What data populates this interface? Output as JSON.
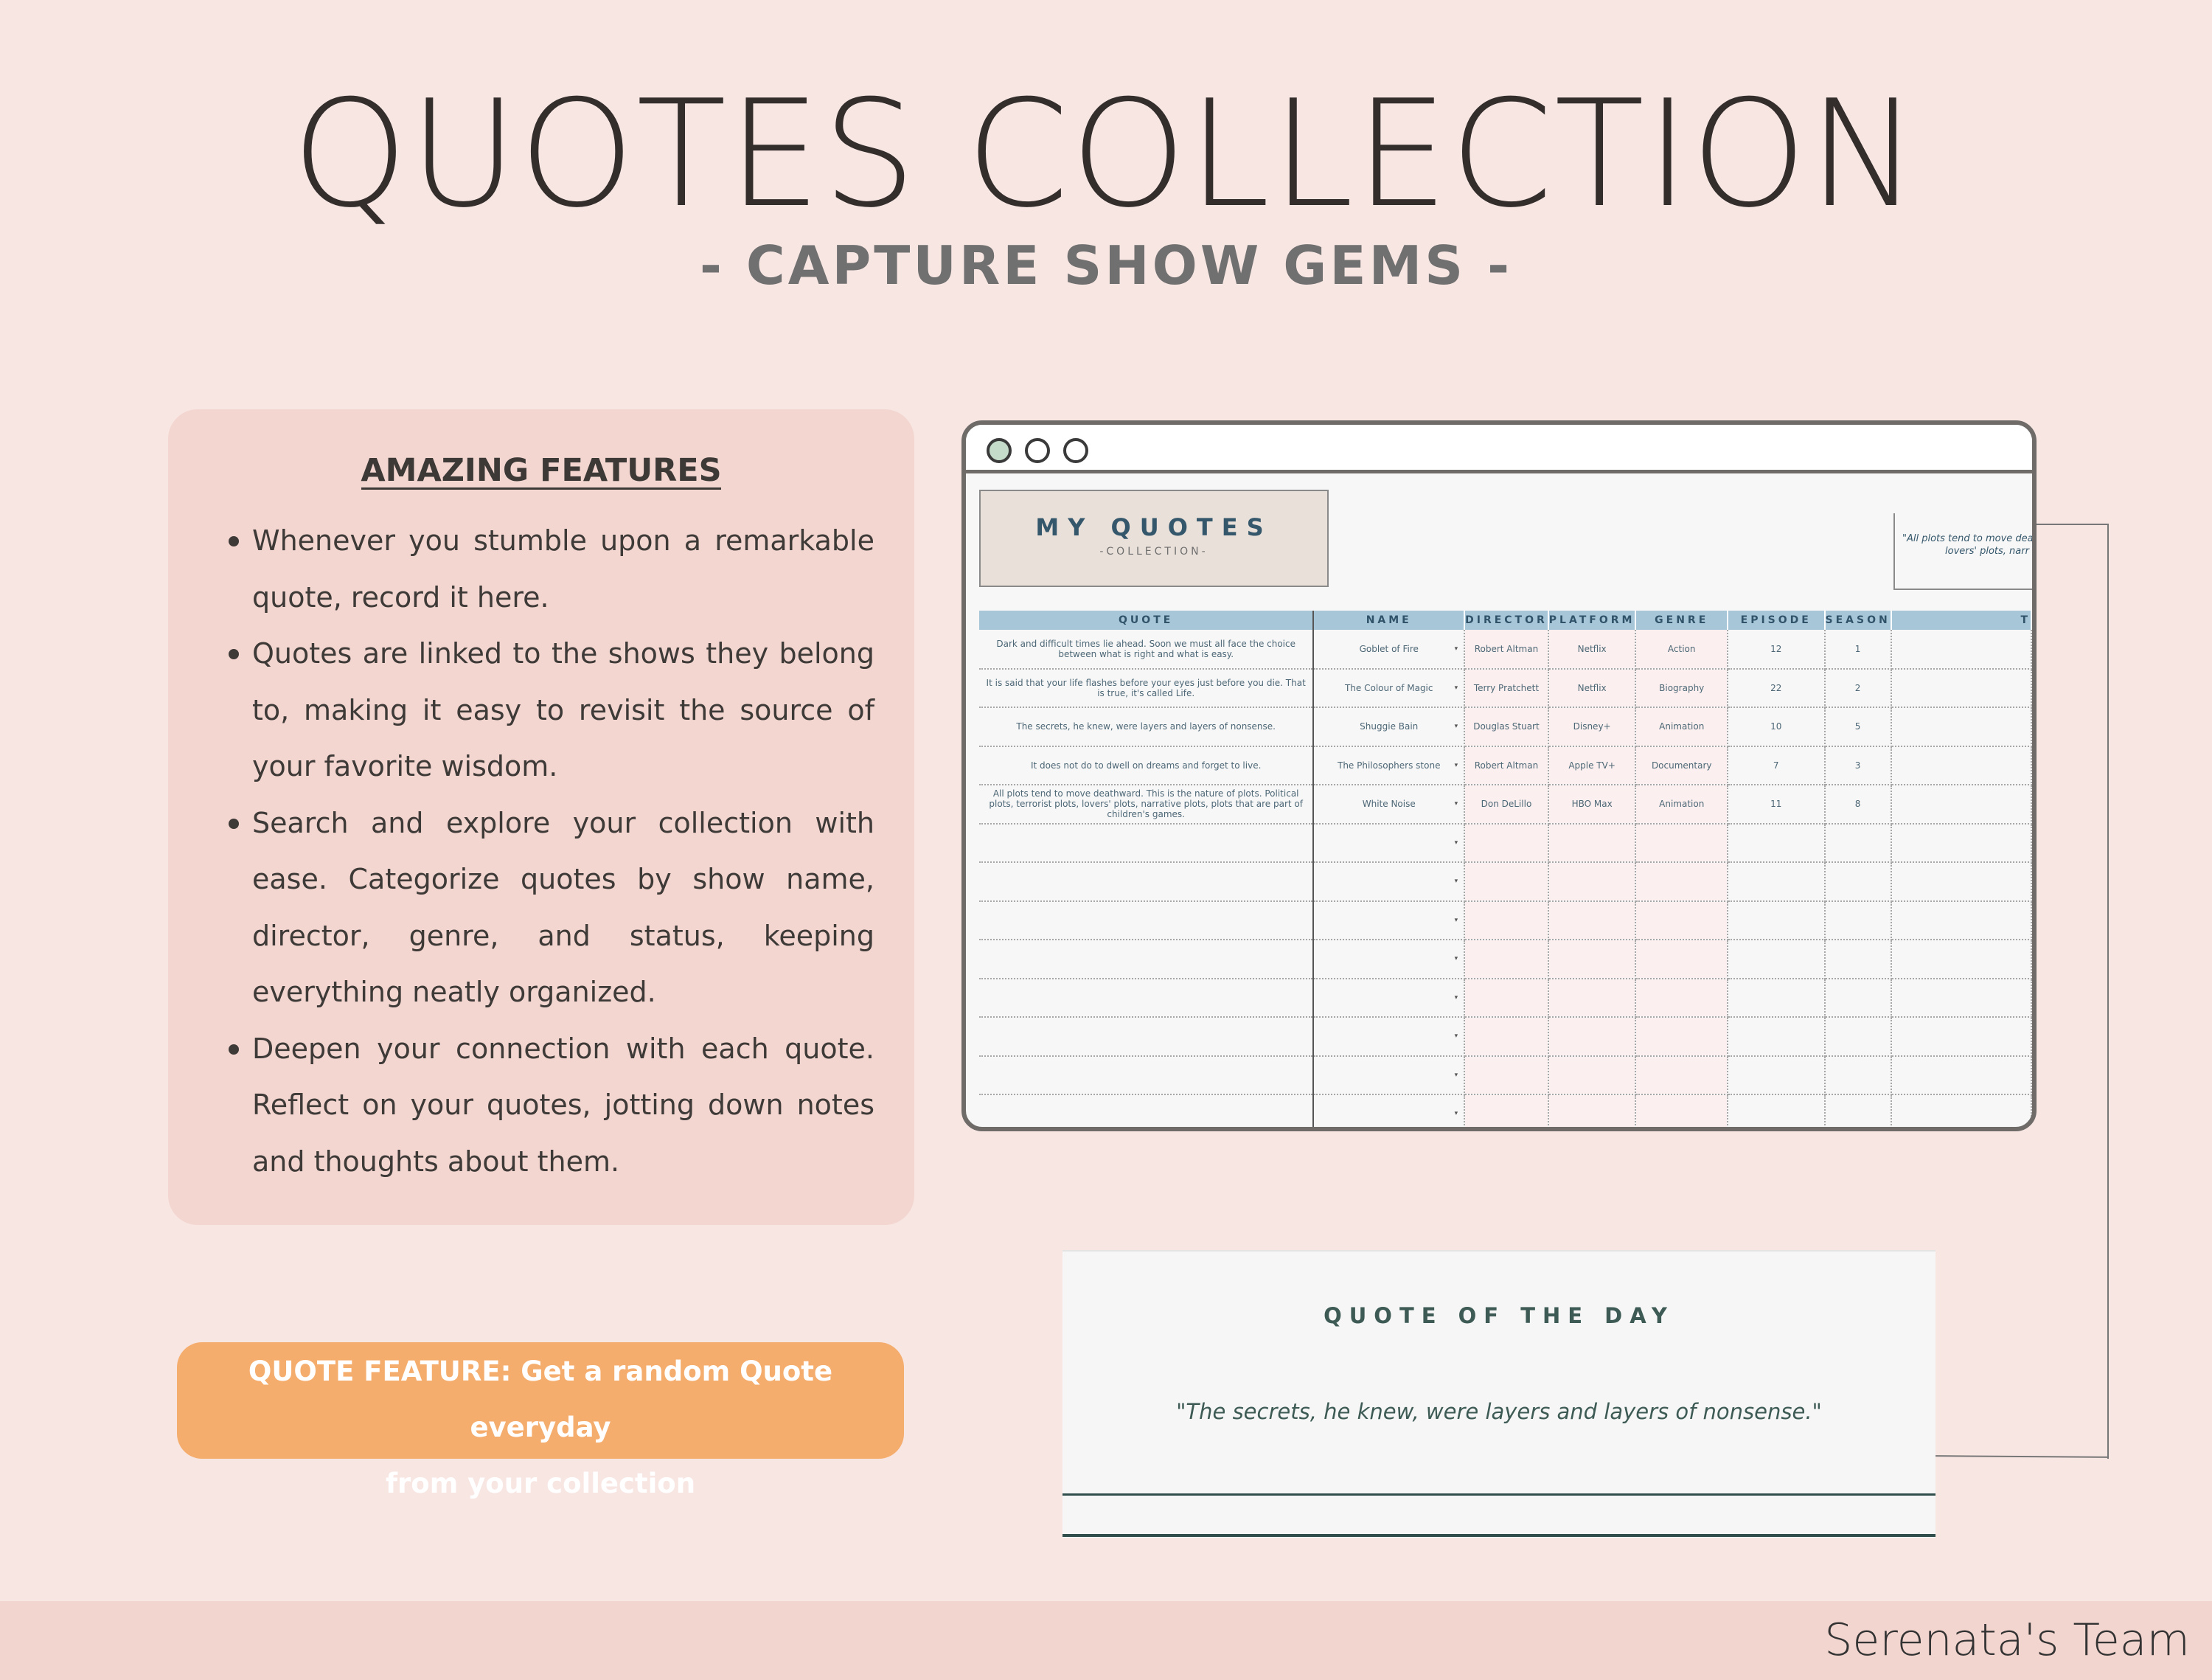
{
  "header": {
    "title": "QUOTES COLLECTION",
    "subtitle": "- CAPTURE SHOW GEMS -"
  },
  "features": {
    "title": "AMAZING FEATURES",
    "items": [
      "Whenever you stumble upon a remarkable quote, record it here.",
      "Quotes are linked to the shows they belong to, making it easy to revisit the source of your favorite wisdom.",
      "Search and explore your collection with ease. Categorize quotes by show name, director, genre, and status, keeping everything neatly organized.",
      "Deepen your connection with each quote. Reflect on your quotes, jotting down notes and thoughts about them."
    ]
  },
  "cta": {
    "line1": "QUOTE FEATURE: Get a random Quote everyday",
    "line2": "from your collection"
  },
  "spreadsheet": {
    "title": "MY QUOTES",
    "subtitle": "-COLLECTION-",
    "side_quote_line1": "\"All plots tend to move deat",
    "side_quote_line2": "lovers' plots, narr",
    "columns": [
      "QUOTE",
      "NAME",
      "DIRECTOR",
      "PLATFORM",
      "GENRE",
      "EPISODE",
      "SEASON",
      "T"
    ],
    "rows": [
      {
        "quote": "Dark and difficult times lie ahead. Soon we must all face the choice between what is right and what is easy.",
        "name": "Goblet of Fire",
        "director": "Robert Altman",
        "platform": "Netflix",
        "genre": "Action",
        "episode": "12",
        "season": "1"
      },
      {
        "quote": "It is said that your life flashes before your eyes just before you die. That is true, it's called Life.",
        "name": "The Colour of Magic",
        "director": "Terry Pratchett",
        "platform": "Netflix",
        "genre": "Biography",
        "episode": "22",
        "season": "2"
      },
      {
        "quote": "The secrets, he knew, were layers and layers of nonsense.",
        "name": "Shuggie Bain",
        "director": "Douglas Stuart",
        "platform": "Disney+",
        "genre": "Animation",
        "episode": "10",
        "season": "5"
      },
      {
        "quote": "It does not do to dwell on dreams and forget to live.",
        "name": "The Philosophers stone",
        "director": "Robert Altman",
        "platform": "Apple TV+",
        "genre": "Documentary",
        "episode": "7",
        "season": "3"
      },
      {
        "quote": "All plots tend to move deathward. This is the nature of plots. Political plots, terrorist plots, lovers' plots, narrative plots, plots that are part of children's games.",
        "name": "White Noise",
        "director": "Don DeLillo",
        "platform": "HBO Max",
        "genre": "Animation",
        "episode": "11",
        "season": "8"
      }
    ],
    "empty_rows": 8
  },
  "quote_of_day": {
    "title": "QUOTE OF THE DAY",
    "text": "\"The secrets, he knew, were layers and layers of nonsense.\""
  },
  "footer": {
    "brand": "Serenata's Team"
  },
  "colors": {
    "background": "#f8e6e3",
    "card": "#f3d6d0",
    "cta": "#f5ad6e",
    "header_row": "#a7c6d8",
    "accent_text": "#35576b"
  }
}
